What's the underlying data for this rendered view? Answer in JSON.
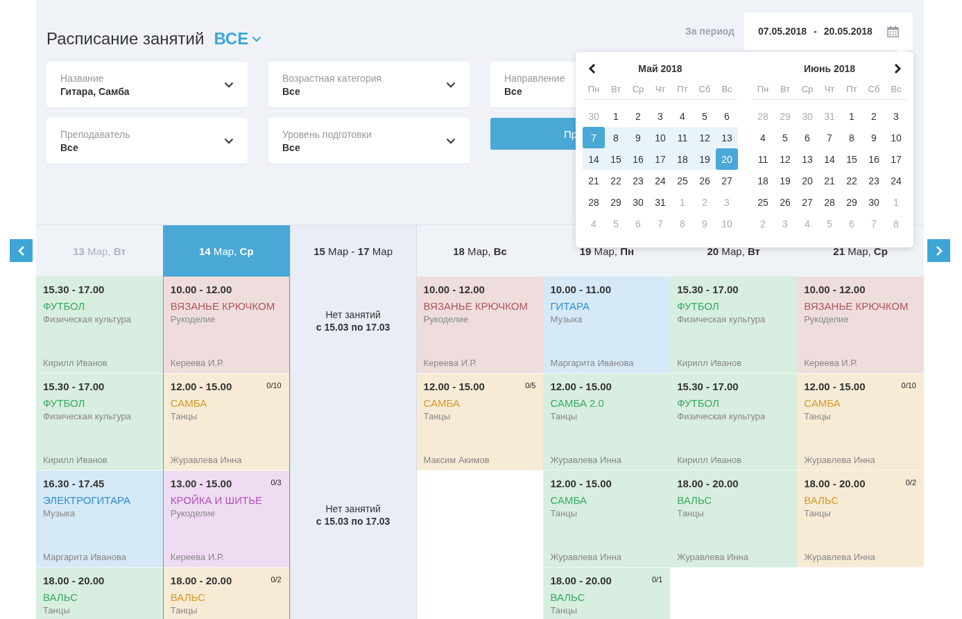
{
  "header": {
    "title": "Расписание занятий",
    "scope": "ВСЕ",
    "period_label": "За период",
    "date_from": "07.05.2018",
    "date_sep": "-",
    "date_to": "20.05.2018"
  },
  "filters": [
    {
      "label": "Название",
      "value": "Гитара, Самба"
    },
    {
      "label": "Возрастная категория",
      "value": "Все"
    },
    {
      "label": "Направление",
      "value": "Все"
    },
    {
      "label": "Преподаватель",
      "value": "Все"
    },
    {
      "label": "Уровень подготовки",
      "value": "Все"
    }
  ],
  "apply_button": {
    "label": "Пр"
  },
  "calendar": {
    "months": [
      {
        "title": "Май 2018",
        "prev": true,
        "next": false,
        "weekdays": [
          "Пн",
          "Вт",
          "Ср",
          "Чт",
          "Пт",
          "Сб",
          "Вс"
        ],
        "weeks": [
          [
            {
              "day": "30",
              "outside": true,
              "selected": false,
              "in_range": false
            },
            {
              "day": "1",
              "outside": false,
              "selected": false,
              "in_range": false
            },
            {
              "day": "2",
              "outside": false,
              "selected": false,
              "in_range": false
            },
            {
              "day": "3",
              "outside": false,
              "selected": false,
              "in_range": false
            },
            {
              "day": "4",
              "outside": false,
              "selected": false,
              "in_range": false
            },
            {
              "day": "5",
              "outside": false,
              "selected": false,
              "in_range": false
            },
            {
              "day": "6",
              "outside": false,
              "selected": false,
              "in_range": false
            }
          ],
          [
            {
              "day": "7",
              "outside": false,
              "selected": true,
              "in_range": true
            },
            {
              "day": "8",
              "outside": false,
              "selected": false,
              "in_range": true
            },
            {
              "day": "9",
              "outside": false,
              "selected": false,
              "in_range": true
            },
            {
              "day": "10",
              "outside": false,
              "selected": false,
              "in_range": true
            },
            {
              "day": "11",
              "outside": false,
              "selected": false,
              "in_range": true
            },
            {
              "day": "12",
              "outside": false,
              "selected": false,
              "in_range": true
            },
            {
              "day": "13",
              "outside": false,
              "selected": false,
              "in_range": true
            }
          ],
          [
            {
              "day": "14",
              "outside": false,
              "selected": false,
              "in_range": true
            },
            {
              "day": "15",
              "outside": false,
              "selected": false,
              "in_range": true
            },
            {
              "day": "16",
              "outside": false,
              "selected": false,
              "in_range": true
            },
            {
              "day": "17",
              "outside": false,
              "selected": false,
              "in_range": true
            },
            {
              "day": "18",
              "outside": false,
              "selected": false,
              "in_range": true
            },
            {
              "day": "19",
              "outside": false,
              "selected": false,
              "in_range": true
            },
            {
              "day": "20",
              "outside": false,
              "selected": true,
              "in_range": true
            }
          ],
          [
            {
              "day": "21",
              "outside": false,
              "selected": false,
              "in_range": false
            },
            {
              "day": "22",
              "outside": false,
              "selected": false,
              "in_range": false
            },
            {
              "day": "23",
              "outside": false,
              "selected": false,
              "in_range": false
            },
            {
              "day": "24",
              "outside": false,
              "selected": false,
              "in_range": false
            },
            {
              "day": "25",
              "outside": false,
              "selected": false,
              "in_range": false
            },
            {
              "day": "26",
              "outside": false,
              "selected": false,
              "in_range": false
            },
            {
              "day": "27",
              "outside": false,
              "selected": false,
              "in_range": false
            }
          ],
          [
            {
              "day": "28",
              "outside": false,
              "selected": false,
              "in_range": false
            },
            {
              "day": "29",
              "outside": false,
              "selected": false,
              "in_range": false
            },
            {
              "day": "30",
              "outside": false,
              "selected": false,
              "in_range": false
            },
            {
              "day": "31",
              "outside": false,
              "selected": false,
              "in_range": false
            },
            {
              "day": "1",
              "outside": true,
              "selected": false,
              "in_range": false
            },
            {
              "day": "2",
              "outside": true,
              "selected": false,
              "in_range": false
            },
            {
              "day": "3",
              "outside": true,
              "selected": false,
              "in_range": false
            }
          ],
          [
            {
              "day": "4",
              "outside": true,
              "selected": false,
              "in_range": false
            },
            {
              "day": "5",
              "outside": true,
              "selected": false,
              "in_range": false
            },
            {
              "day": "6",
              "outside": true,
              "selected": false,
              "in_range": false
            },
            {
              "day": "7",
              "outside": true,
              "selected": false,
              "in_range": false
            },
            {
              "day": "8",
              "outside": true,
              "selected": false,
              "in_range": false
            },
            {
              "day": "9",
              "outside": true,
              "selected": false,
              "in_range": false
            },
            {
              "day": "10",
              "outside": true,
              "selected": false,
              "in_range": false
            }
          ]
        ]
      },
      {
        "title": "Июнь 2018",
        "prev": false,
        "next": true,
        "weekdays": [
          "Пн",
          "Вт",
          "Ср",
          "Чт",
          "Пт",
          "Сб",
          "Вс"
        ],
        "weeks": [
          [
            {
              "day": "28",
              "outside": true,
              "selected": false,
              "in_range": false
            },
            {
              "day": "29",
              "outside": true,
              "selected": false,
              "in_range": false
            },
            {
              "day": "30",
              "outside": true,
              "selected": false,
              "in_range": false
            },
            {
              "day": "31",
              "outside": true,
              "selected": false,
              "in_range": false
            },
            {
              "day": "1",
              "outside": false,
              "selected": false,
              "in_range": false
            },
            {
              "day": "2",
              "outside": false,
              "selected": false,
              "in_range": false
            },
            {
              "day": "3",
              "outside": false,
              "selected": false,
              "in_range": false
            }
          ],
          [
            {
              "day": "4",
              "outside": false,
              "selected": false,
              "in_range": false
            },
            {
              "day": "5",
              "outside": false,
              "selected": false,
              "in_range": false
            },
            {
              "day": "6",
              "outside": false,
              "selected": false,
              "in_range": false
            },
            {
              "day": "7",
              "outside": false,
              "selected": false,
              "in_range": false
            },
            {
              "day": "8",
              "outside": false,
              "selected": false,
              "in_range": false
            },
            {
              "day": "9",
              "outside": false,
              "selected": false,
              "in_range": false
            },
            {
              "day": "10",
              "outside": false,
              "selected": false,
              "in_range": false
            }
          ],
          [
            {
              "day": "11",
              "outside": false,
              "selected": false,
              "in_range": false
            },
            {
              "day": "12",
              "outside": false,
              "selected": false,
              "in_range": false
            },
            {
              "day": "13",
              "outside": false,
              "selected": false,
              "in_range": false
            },
            {
              "day": "14",
              "outside": false,
              "selected": false,
              "in_range": false
            },
            {
              "day": "15",
              "outside": false,
              "selected": false,
              "in_range": false
            },
            {
              "day": "16",
              "outside": false,
              "selected": false,
              "in_range": false
            },
            {
              "day": "17",
              "outside": false,
              "selected": false,
              "in_range": false
            }
          ],
          [
            {
              "day": "18",
              "outside": false,
              "selected": false,
              "in_range": false
            },
            {
              "day": "19",
              "outside": false,
              "selected": false,
              "in_range": false
            },
            {
              "day": "20",
              "outside": false,
              "selected": false,
              "in_range": false
            },
            {
              "day": "21",
              "outside": false,
              "selected": false,
              "in_range": false
            },
            {
              "day": "22",
              "outside": false,
              "selected": false,
              "in_range": false
            },
            {
              "day": "23",
              "outside": false,
              "selected": false,
              "in_range": false
            },
            {
              "day": "24",
              "outside": false,
              "selected": false,
              "in_range": false
            }
          ],
          [
            {
              "day": "25",
              "outside": false,
              "selected": false,
              "in_range": false
            },
            {
              "day": "26",
              "outside": false,
              "selected": false,
              "in_range": false
            },
            {
              "day": "27",
              "outside": false,
              "selected": false,
              "in_range": false
            },
            {
              "day": "28",
              "outside": false,
              "selected": false,
              "in_range": false
            },
            {
              "day": "29",
              "outside": false,
              "selected": false,
              "in_range": false
            },
            {
              "day": "30",
              "outside": false,
              "selected": false,
              "in_range": false
            },
            {
              "day": "1",
              "outside": true,
              "selected": false,
              "in_range": false
            }
          ],
          [
            {
              "day": "2",
              "outside": true,
              "selected": false,
              "in_range": false
            },
            {
              "day": "3",
              "outside": true,
              "selected": false,
              "in_range": false
            },
            {
              "day": "4",
              "outside": true,
              "selected": false,
              "in_range": false
            },
            {
              "day": "5",
              "outside": true,
              "selected": false,
              "in_range": false
            },
            {
              "day": "6",
              "outside": true,
              "selected": false,
              "in_range": false
            },
            {
              "day": "7",
              "outside": true,
              "selected": false,
              "in_range": false
            },
            {
              "day": "8",
              "outside": true,
              "selected": false,
              "in_range": false
            }
          ]
        ]
      }
    ]
  },
  "schedule": {
    "columns": [
      {
        "kind": "day",
        "label": "**13** Мар, **Вт**",
        "selected": false,
        "muted": true,
        "events": [
          {
            "time": "15.30 - 17.00",
            "title": "ФУТБОЛ",
            "category": "Физическая культура",
            "teacher": "Кирилл Иванов",
            "color": "#3aaa63"
          },
          {
            "time": "15.30 - 17.00",
            "title": "ФУТБОЛ",
            "category": "Физическая культура",
            "teacher": "Кирилл Иванов",
            "color": "#3aaa63"
          },
          {
            "time": "16.30 - 17.45",
            "title": "ЭЛЕКТРОГИТАРА",
            "category": "Музыка",
            "teacher": "Маргарита Иванова",
            "color": "#2d8fd5"
          },
          {
            "time": "18.00 - 20.00",
            "title": "ВАЛЬС",
            "category": "Танцы",
            "color": "#3aaa63"
          }
        ]
      },
      {
        "kind": "day",
        "label": "**14** Мар, **Ср**",
        "selected": true,
        "muted": false,
        "events": [
          {
            "time": "10.00 - 12.00",
            "title": "ВЯЗАНЬЕ КРЮЧКОМ",
            "category": "Рукоделие",
            "teacher": "Кереева И.Р.",
            "color": "#b0575a"
          },
          {
            "time": "12.00 - 15.00",
            "seats": "0/10",
            "title": "САМБА",
            "category": "Танцы",
            "teacher": "Журавлева Инна",
            "color": "#d79a2e"
          },
          {
            "time": "13.00 - 15.00",
            "seats": "0/3",
            "title": "КРОЙКА И ШИТЬЕ",
            "category": "Рукоделие",
            "teacher": "Кереева И.Р.",
            "color": "#b150c0"
          },
          {
            "time": "18.00 - 20.00",
            "seats": "0/2",
            "title": "ВАЛЬС",
            "category": "Танцы",
            "color": "#d79a2e"
          }
        ]
      },
      {
        "kind": "gap",
        "label": "**15** Мар - **17** Мар",
        "selected": false,
        "muted": false,
        "notes": [
          {
            "text": "Нет занятий",
            "period": "с 15.03 по 17.03"
          },
          {
            "text": "Нет занятий",
            "period": "с 15.03 по 17.03"
          }
        ]
      },
      {
        "kind": "day",
        "label": "**18** Мар, **Вс**",
        "selected": false,
        "muted": false,
        "events": [
          {
            "time": "10.00 - 12.00",
            "title": "ВЯЗАНЬЕ КРЮЧКОМ",
            "category": "Рукоделие",
            "teacher": "Кереева И.Р.",
            "color": "#b0575a"
          },
          {
            "time": "12.00 - 15.00",
            "seats": "0/5",
            "title": "САМБА",
            "category": "Танцы",
            "teacher": "Максим Акимов",
            "color": "#d79a2e"
          }
        ]
      },
      {
        "kind": "day",
        "label": "**19** Мар, **Пн**",
        "selected": false,
        "muted": false,
        "events": [
          {
            "time": "10.00 - 11.00",
            "title": "ГИТАРА",
            "category": "Музыка",
            "teacher": "Маргарита Иванова",
            "color": "#2d8fd5"
          },
          {
            "time": "12.00 - 15.00",
            "title": "САМБА 2.0",
            "category": "Танцы",
            "teacher": "Журавлева Инна",
            "color": "#3aaa63"
          },
          {
            "time": "12.00 - 15.00",
            "title": "САМБА",
            "category": "Танцы",
            "teacher": "Журавлева Инна",
            "color": "#3aaa63"
          },
          {
            "time": "18.00 - 20.00",
            "seats": "0/1",
            "title": "ВАЛЬС",
            "category": "Танцы",
            "color": "#3aaa63"
          }
        ]
      },
      {
        "kind": "day",
        "label": "**20** Мар, **Вт**",
        "selected": false,
        "muted": false,
        "events": [
          {
            "time": "15.30 - 17.00",
            "title": "ФУТБОЛ",
            "category": "Физическая культура",
            "teacher": "Кирилл Иванов",
            "color": "#3aaa63"
          },
          {
            "time": "15.30 - 17.00",
            "title": "ФУТБОЛ",
            "category": "Физическая культура",
            "teacher": "Кирилл Иванов",
            "color": "#3aaa63"
          },
          {
            "time": "18.00 - 20.00",
            "title": "ВАЛЬС",
            "category": "Танцы",
            "teacher": "Журавлева Инна",
            "color": "#3aaa63"
          }
        ]
      },
      {
        "kind": "day",
        "label": "**21** Мар, **Ср**",
        "selected": false,
        "muted": false,
        "events": [
          {
            "time": "10.00 - 12.00",
            "title": "ВЯЗАНЬЕ КРЮЧКОМ",
            "category": "Рукоделие",
            "teacher": "Кереева И.Р.",
            "color": "#b0575a"
          },
          {
            "time": "12.00 - 15.00",
            "seats": "0/10",
            "title": "САМБА",
            "category": "Танцы",
            "teacher": "Журавлева Инна",
            "color": "#d79a2e"
          },
          {
            "time": "18.00 - 20.00",
            "seats": "0/2",
            "title": "ВАЛЬС",
            "category": "Танцы",
            "teacher": "Журавлева Инна",
            "color": "#d79a2e"
          }
        ]
      }
    ]
  }
}
